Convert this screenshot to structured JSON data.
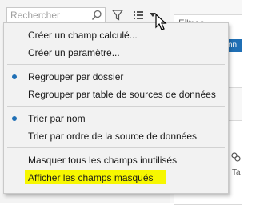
{
  "search": {
    "placeholder": "Rechercher"
  },
  "right_panel": {
    "label": "Filtres",
    "button_text": "nn",
    "small_text": "Ta"
  },
  "menu": {
    "items": [
      {
        "label": "Créer un champ calculé..."
      },
      {
        "label": "Créer un paramètre..."
      },
      {
        "label": "Regrouper par dossier",
        "selected": true
      },
      {
        "label": "Regrouper par table de sources de données",
        "selected": false
      },
      {
        "label": "Trier par nom",
        "selected": true
      },
      {
        "label": "Trier par ordre de la source de données",
        "selected": false
      },
      {
        "label": "Masquer tous les champs inutilisés"
      },
      {
        "label": "Afficher les champs masqués",
        "highlighted": true
      }
    ]
  },
  "colors": {
    "bullet": "#1f6fb5",
    "highlight": "#f7f700",
    "accent": "#1f6fb5"
  }
}
